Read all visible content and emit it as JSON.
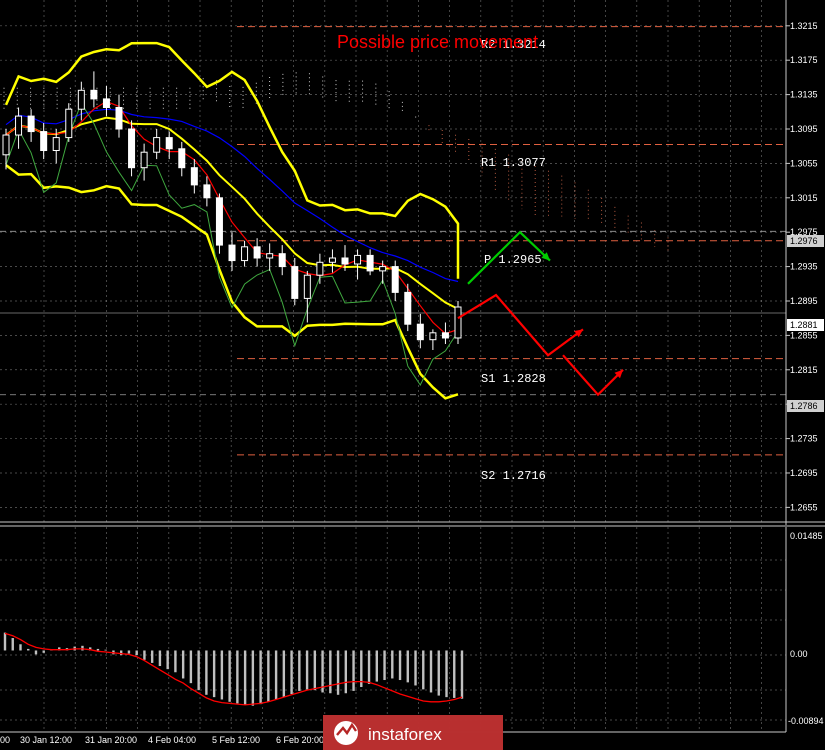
{
  "chart_data": {
    "type": "candlestick",
    "title": "Possible price movement",
    "price_axis": {
      "ylim": [
        1.2638,
        1.3245
      ],
      "ticks": [
        "1.3215",
        "1.3175",
        "1.3135",
        "1.3095",
        "1.3055",
        "1.3015",
        "1.2975",
        "1.2935",
        "1.2895",
        "1.2855",
        "1.2815",
        "1.2775",
        "1.2735",
        "1.2695",
        "1.2655"
      ],
      "current_price": "1.2881",
      "marker_level": "1.2976",
      "marker_level_2": "1.2786"
    },
    "time_axis": {
      "labels": [
        "00",
        "30 Jan 12:00",
        "31 Jan 20:00",
        "4 Feb 04:00",
        "5 Feb 12:00",
        "6 Feb 20:00"
      ]
    },
    "levels": [
      {
        "name": "R2",
        "label": "R2 1.3214",
        "value": 1.3214
      },
      {
        "name": "R1",
        "label": "R1 1.3077",
        "value": 1.3077
      },
      {
        "name": "P",
        "label": "P 1.2965",
        "value": 1.2965
      },
      {
        "name": "S1",
        "label": "S1 1.2828",
        "value": 1.2828
      },
      {
        "name": "S2",
        "label": "S2 1.2716",
        "value": 1.2716
      }
    ],
    "candles": [
      [
        1.3065,
        1.3095,
        1.3048,
        1.3088
      ],
      [
        1.3088,
        1.312,
        1.3072,
        1.311
      ],
      [
        1.311,
        1.3118,
        1.308,
        1.3092
      ],
      [
        1.3092,
        1.3102,
        1.306,
        1.307
      ],
      [
        1.307,
        1.3095,
        1.3055,
        1.3085
      ],
      [
        1.3085,
        1.3125,
        1.308,
        1.3118
      ],
      [
        1.3118,
        1.315,
        1.3105,
        1.314
      ],
      [
        1.314,
        1.3162,
        1.312,
        1.313
      ],
      [
        1.313,
        1.3145,
        1.311,
        1.312
      ],
      [
        1.312,
        1.3135,
        1.3085,
        1.3095
      ],
      [
        1.3095,
        1.3105,
        1.304,
        1.305
      ],
      [
        1.305,
        1.3078,
        1.3035,
        1.3068
      ],
      [
        1.3068,
        1.3095,
        1.306,
        1.3085
      ],
      [
        1.3085,
        1.3092,
        1.306,
        1.3072
      ],
      [
        1.3072,
        1.308,
        1.304,
        1.305
      ],
      [
        1.305,
        1.306,
        1.302,
        1.303
      ],
      [
        1.303,
        1.304,
        1.3005,
        1.3015
      ],
      [
        1.3015,
        1.302,
        1.295,
        1.296
      ],
      [
        1.296,
        1.2975,
        1.293,
        1.2942
      ],
      [
        1.2942,
        1.2965,
        1.2935,
        1.2958
      ],
      [
        1.2958,
        1.2968,
        1.2935,
        1.2945
      ],
      [
        1.2945,
        1.2962,
        1.293,
        1.295
      ],
      [
        1.295,
        1.296,
        1.2925,
        1.2935
      ],
      [
        1.2935,
        1.2945,
        1.289,
        1.2898
      ],
      [
        1.2898,
        1.293,
        1.287,
        1.2925
      ],
      [
        1.2925,
        1.295,
        1.2915,
        1.294
      ],
      [
        1.294,
        1.2955,
        1.2928,
        1.2945
      ],
      [
        1.2945,
        1.296,
        1.293,
        1.2938
      ],
      [
        1.2938,
        1.2955,
        1.292,
        1.2948
      ],
      [
        1.2948,
        1.2955,
        1.2925,
        1.293
      ],
      [
        1.293,
        1.2942,
        1.2915,
        1.2935
      ],
      [
        1.2935,
        1.2942,
        1.2895,
        1.2905
      ],
      [
        1.2905,
        1.2915,
        1.286,
        1.2868
      ],
      [
        1.2868,
        1.288,
        1.284,
        1.285
      ],
      [
        1.285,
        1.2862,
        1.2838,
        1.2858
      ],
      [
        1.2858,
        1.287,
        1.2845,
        1.2852
      ],
      [
        1.2852,
        1.2895,
        1.2845,
        1.2888
      ]
    ],
    "forecast": {
      "green": [
        [
          1.2915,
          0
        ],
        [
          1.2975,
          52
        ],
        [
          1.2942,
          82
        ]
      ],
      "red": [
        [
          1.2875,
          -10
        ],
        [
          1.2902,
          28
        ],
        [
          1.2832,
          80
        ],
        [
          1.2862,
          115
        ]
      ],
      "red_2": [
        [
          1.2832,
          95
        ],
        [
          1.2786,
          130
        ],
        [
          1.2815,
          155
        ]
      ]
    },
    "macd": {
      "ylim": [
        -0.00894,
        0.01485
      ],
      "ticks": [
        "0.01485",
        "0.00",
        "-0.00894"
      ],
      "histogram": [
        0.0023,
        0.0016,
        0.0008,
        0.0002,
        -0.0005,
        -0.0003,
        0.0001,
        0.0004,
        0.0003,
        0.0005,
        0.0006,
        0.0004,
        0.0002,
        0.0001,
        -0.0005,
        -0.0006,
        -0.0004,
        -0.0006,
        -0.0012,
        -0.0016,
        -0.002,
        -0.0024,
        -0.0028,
        -0.0036,
        -0.0042,
        -0.0051,
        -0.0057,
        -0.006,
        -0.0063,
        -0.0066,
        -0.0068,
        -0.007,
        -0.0071,
        -0.0069,
        -0.0066,
        -0.0063,
        -0.006,
        -0.0056,
        -0.0052,
        -0.005,
        -0.0051,
        -0.0054,
        -0.0055,
        -0.0057,
        -0.0055,
        -0.0052,
        -0.0047,
        -0.0043,
        -0.004,
        -0.0038,
        -0.0036,
        -0.0038,
        -0.0041,
        -0.0045,
        -0.005,
        -0.0054,
        -0.0058,
        -0.006,
        -0.0061,
        -0.0062
      ],
      "signal": [
        0.0022,
        0.0019,
        0.0014,
        0.0008,
        0.0004,
        0.0002,
        0.0001,
        0.0001,
        0.0001,
        0.0002,
        0.0002,
        0.0001,
        -0.0001,
        -0.0002,
        -0.0003,
        -0.0004,
        -0.0005,
        -0.0008,
        -0.0013,
        -0.0019,
        -0.0025,
        -0.0031,
        -0.0037,
        -0.0042,
        -0.0049,
        -0.0055,
        -0.0061,
        -0.0065,
        -0.0067,
        -0.0068,
        -0.0069,
        -0.007,
        -0.0069,
        -0.0068,
        -0.0066,
        -0.0063,
        -0.006,
        -0.0057,
        -0.0054,
        -0.0051,
        -0.0049,
        -0.0047,
        -0.0045,
        -0.0043,
        -0.0041,
        -0.004,
        -0.004,
        -0.0041,
        -0.0044,
        -0.0048,
        -0.0052,
        -0.0056,
        -0.0059,
        -0.0062,
        -0.0065,
        -0.0066,
        -0.0066,
        -0.0065,
        -0.0063,
        -0.006
      ]
    }
  },
  "logo": {
    "text": "instaforex"
  },
  "colors": {
    "background": "#000000",
    "grid": "#b3b3b3",
    "bull": "#ffffff",
    "bear": "#ffffff",
    "bands": "#ffff00",
    "kijun": "#0000ff",
    "tenkan": "#ff0000",
    "chikou": "#3fa83f",
    "cloud_bull": "#ffffff",
    "cloud_bear": "#e07050",
    "forecast_green": "#00cc00",
    "forecast_red": "#ff0000",
    "levels": "#e06040",
    "macd_hist": "#c0c0c0",
    "macd_signal": "#ff0000"
  }
}
